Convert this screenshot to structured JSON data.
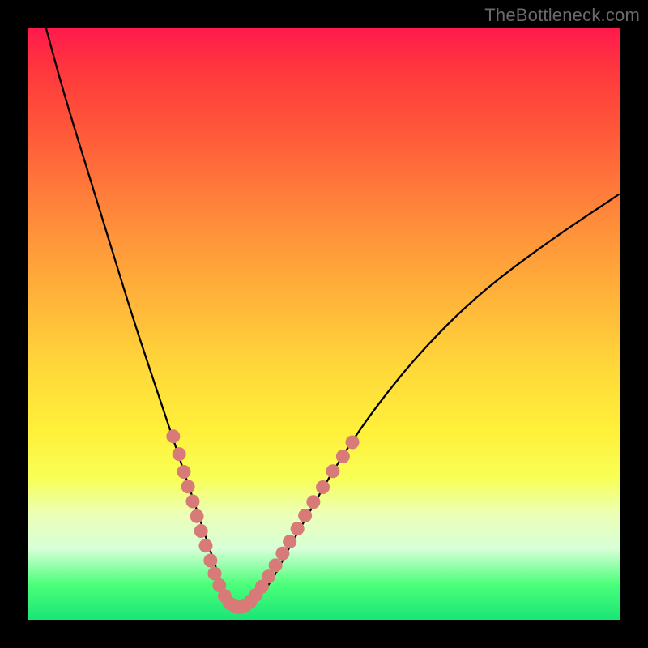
{
  "watermark": "TheBottleneck.com",
  "colors": {
    "page_bg": "#000000",
    "gradient_top": "#ff1a4d",
    "gradient_bottom": "#19e676",
    "curve": "#000000",
    "marker_fill": "#d87a78",
    "marker_stroke": "#c96260"
  },
  "chart_data": {
    "type": "line",
    "title": "",
    "xlabel": "",
    "ylabel": "",
    "xlim": [
      0,
      100
    ],
    "ylim": [
      0,
      100
    ],
    "grid": false,
    "legend": false,
    "series": [
      {
        "name": "curve",
        "x": [
          3,
          6,
          10,
          14,
          18,
          22,
          24,
          26,
          28,
          30,
          31,
          32,
          33,
          34,
          35,
          36,
          37,
          38,
          40,
          42,
          44,
          48,
          52,
          58,
          66,
          76,
          88,
          100
        ],
        "y": [
          100,
          89,
          76,
          63,
          50,
          38,
          32,
          26,
          20,
          14,
          11,
          8,
          5,
          3,
          2,
          2,
          2,
          3,
          5,
          8,
          12,
          19,
          26,
          35,
          45,
          55,
          64,
          72
        ]
      }
    ],
    "markers": [
      {
        "x": 24.5,
        "y": 31
      },
      {
        "x": 25.5,
        "y": 28
      },
      {
        "x": 26.3,
        "y": 25
      },
      {
        "x": 27.0,
        "y": 22.5
      },
      {
        "x": 27.8,
        "y": 20
      },
      {
        "x": 28.5,
        "y": 17.5
      },
      {
        "x": 29.2,
        "y": 15
      },
      {
        "x": 30.0,
        "y": 12.5
      },
      {
        "x": 30.8,
        "y": 10
      },
      {
        "x": 31.5,
        "y": 7.8
      },
      {
        "x": 32.3,
        "y": 5.8
      },
      {
        "x": 33.2,
        "y": 4.0
      },
      {
        "x": 34.0,
        "y": 2.8
      },
      {
        "x": 35.0,
        "y": 2.2
      },
      {
        "x": 35.8,
        "y": 2.1
      },
      {
        "x": 36.6,
        "y": 2.3
      },
      {
        "x": 37.5,
        "y": 3.0
      },
      {
        "x": 38.5,
        "y": 4.2
      },
      {
        "x": 39.5,
        "y": 5.6
      },
      {
        "x": 40.6,
        "y": 7.3
      },
      {
        "x": 41.8,
        "y": 9.2
      },
      {
        "x": 43.0,
        "y": 11.2
      },
      {
        "x": 44.2,
        "y": 13.2
      },
      {
        "x": 45.5,
        "y": 15.4
      },
      {
        "x": 46.8,
        "y": 17.6
      },
      {
        "x": 48.2,
        "y": 19.9
      },
      {
        "x": 49.8,
        "y": 22.4
      },
      {
        "x": 51.5,
        "y": 25.1
      },
      {
        "x": 53.2,
        "y": 27.6
      },
      {
        "x": 54.8,
        "y": 30.0
      }
    ]
  }
}
